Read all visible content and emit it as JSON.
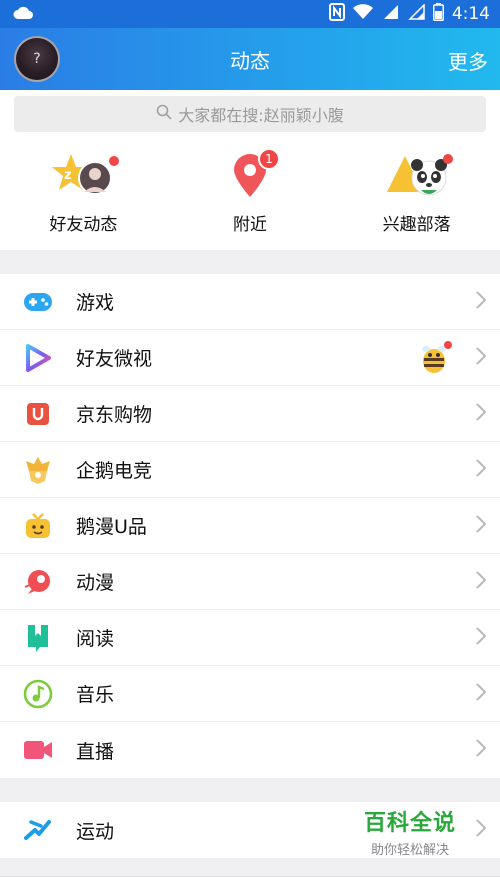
{
  "status_bar": {
    "time": "4:14",
    "icons": [
      "cloud-icon",
      "nfc-icon",
      "wifi-icon",
      "signal-icon",
      "battery-icon"
    ]
  },
  "header": {
    "title": "动态",
    "more_label": "更多",
    "avatar_glyph": "?"
  },
  "search": {
    "placeholder": "大家都在搜:赵丽颖小腹"
  },
  "quick_items": [
    {
      "label": "好友动态",
      "icon": "friend-feed-icon",
      "has_dot": true
    },
    {
      "label": "附近",
      "icon": "nearby-pin-icon",
      "badge": "1"
    },
    {
      "label": "兴趣部落",
      "icon": "interest-tribe-icon",
      "has_dot": true
    }
  ],
  "menu_group_1": [
    {
      "label": "游戏",
      "icon": "gamepad-icon",
      "color": "#2aa7f0"
    },
    {
      "label": "好友微视",
      "icon": "play-triangle-icon",
      "color": "#7b5cf0"
    },
    {
      "label": "京东购物",
      "icon": "jd-bag-icon",
      "color": "#e9523f"
    },
    {
      "label": "企鹅电竞",
      "icon": "esports-crown-icon",
      "color": "#f3b43a"
    },
    {
      "label": "鹅漫U品",
      "icon": "tv-face-icon",
      "color": "#f6c133"
    },
    {
      "label": "动漫",
      "icon": "comic-rocket-icon",
      "color": "#ef4e52"
    },
    {
      "label": "阅读",
      "icon": "book-icon",
      "color": "#1fbf99"
    },
    {
      "label": "音乐",
      "icon": "music-note-icon",
      "color": "#7fcb3e"
    },
    {
      "label": "直播",
      "icon": "video-camera-icon",
      "color": "#f2557a"
    }
  ],
  "menu_group_2": [
    {
      "label": "运动",
      "icon": "running-icon",
      "color": "#1e9ce8"
    }
  ],
  "watermark": {
    "title": "百科全说",
    "subtitle": "助你轻松解决"
  },
  "colors": {
    "header_start": "#2a7de6",
    "header_end": "#21b9ee",
    "badge_red": "#f04646"
  }
}
